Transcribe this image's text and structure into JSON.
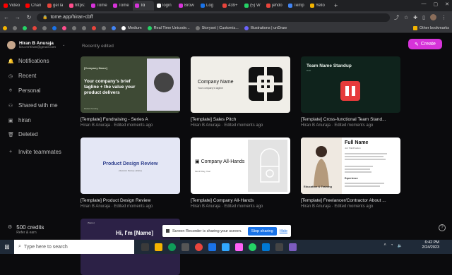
{
  "browser": {
    "tabs": [
      {
        "label": "Video",
        "color": "#ff0000"
      },
      {
        "label": "Chan",
        "color": "#ff0000"
      },
      {
        "label": "gel la",
        "color": "#e8453c"
      },
      {
        "label": "https:",
        "color": "#ff4d8d"
      },
      {
        "label": "Tome",
        "color": "#d633d9"
      },
      {
        "label": "Tome",
        "color": "#d633d9"
      },
      {
        "label": "To",
        "color": "#d633d9",
        "active": true
      },
      {
        "label": "login",
        "color": "#ffffff"
      },
      {
        "label": "Brow",
        "color": "#d633d9"
      },
      {
        "label": "Log",
        "color": "#1a73e8"
      },
      {
        "label": "439+",
        "color": "#e8453c"
      },
      {
        "label": "(5) W",
        "color": "#25d366"
      },
      {
        "label": "jehdo",
        "color": "#e8453c"
      },
      {
        "label": "Temp",
        "color": "#4285f4"
      },
      {
        "label": "Yello",
        "color": "#f4b400"
      }
    ],
    "new_tab": "+",
    "url": "tome.app/hiran-cbff",
    "bookmarks": [
      {
        "label": "",
        "color": "#f4b400"
      },
      {
        "label": "",
        "color": "#777"
      },
      {
        "label": "",
        "color": "#25d366"
      },
      {
        "label": "",
        "color": "#e8453c"
      },
      {
        "label": "",
        "color": "#777"
      },
      {
        "label": "",
        "color": "#1a73e8"
      },
      {
        "label": "",
        "color": "#ff4d8d"
      },
      {
        "label": "",
        "color": "#777"
      },
      {
        "label": "",
        "color": "#777"
      },
      {
        "label": "",
        "color": "#e8453c"
      },
      {
        "label": "",
        "color": "#777"
      },
      {
        "label": "",
        "color": "#4285f4"
      },
      {
        "label": "Medium",
        "color": "#ffffff"
      },
      {
        "label": "Real Time Unicode...",
        "color": "#25d366"
      },
      {
        "label": "Storyset | Customiz...",
        "color": "#777"
      },
      {
        "label": "Illustrations | unDraw",
        "color": "#6c63ff"
      }
    ],
    "other_bookmarks": "Other bookmarks"
  },
  "user": {
    "name": "Hiran B Anuraja",
    "email": "kiru.mrhiran@gmail.com"
  },
  "sidebar": {
    "items": [
      {
        "label": "Notifications",
        "icon": "bell-icon",
        "glyph": "🔔"
      },
      {
        "label": "Recent",
        "icon": "clock-icon",
        "glyph": "◷"
      },
      {
        "label": "Personal",
        "icon": "user-icon",
        "glyph": "⍟"
      },
      {
        "label": "Shared with me",
        "icon": "people-icon",
        "glyph": "⚇"
      },
      {
        "label": "hiran",
        "icon": "lock-icon",
        "glyph": "▣"
      },
      {
        "label": "Deleted",
        "icon": "trash-icon",
        "glyph": "🗑"
      },
      {
        "label": "Invite teammates",
        "icon": "add-user-icon",
        "glyph": "+"
      }
    ],
    "credits": {
      "value": "500 credits",
      "sub": "Refer & earn"
    }
  },
  "main": {
    "section_label": "Recently edited",
    "create_label": "Create",
    "create_color": "#d633d9",
    "cards": [
      {
        "title": "[Template] Fundraising - Series A",
        "meta": "Hiran B Anuraja · Edited moments ago"
      },
      {
        "title": "[Template] Sales Pitch",
        "meta": "Hiran B Anuraja · Edited moments ago"
      },
      {
        "title": "[Template] Cross-functional Team Stand...",
        "meta": "Hiran B Anuraja · Edited moments ago"
      },
      {
        "title": "[Template] Product Design Review",
        "meta": "Hiran B Anuraja · Edited moments ago"
      },
      {
        "title": "[Template] Company All-Hands",
        "meta": "Hiran B Anuraja · Edited moments ago"
      },
      {
        "title": "[Template] Freelancer/Contractor About ...",
        "meta": "Hiran B Anuraja · Edited moments ago"
      }
    ],
    "thumbs": {
      "fundraising": {
        "label": "[Company Name]",
        "headline": "Your company's brief tagline + the value your product delivers",
        "footer": "Raised funding"
      },
      "sales": {
        "name": "Company Name",
        "tagline": "Your company's tagline"
      },
      "standup": {
        "title": "Team Name Standup",
        "sub": "Date"
      },
      "design": {
        "title": "Product Design Review",
        "sub": "[Session Name] • [Date]"
      },
      "allhands": {
        "title": "Company All-Hands",
        "sub": "Month Day, Year"
      },
      "freelancer": {
        "name": "Full Name",
        "job": "Job Title/Position",
        "education": "Education & Training",
        "experience": "Experience"
      },
      "portfolio": {
        "hi": "Hi, I'm [Name]",
        "small": "[Name]"
      }
    }
  },
  "recorder": {
    "text": "Screen Recorder is sharing your screen.",
    "stop": "Stop sharing",
    "hide": "Hide"
  },
  "taskbar": {
    "search_placeholder": "Type here to search",
    "time": "6:42 PM",
    "date": "2/24/2023"
  }
}
